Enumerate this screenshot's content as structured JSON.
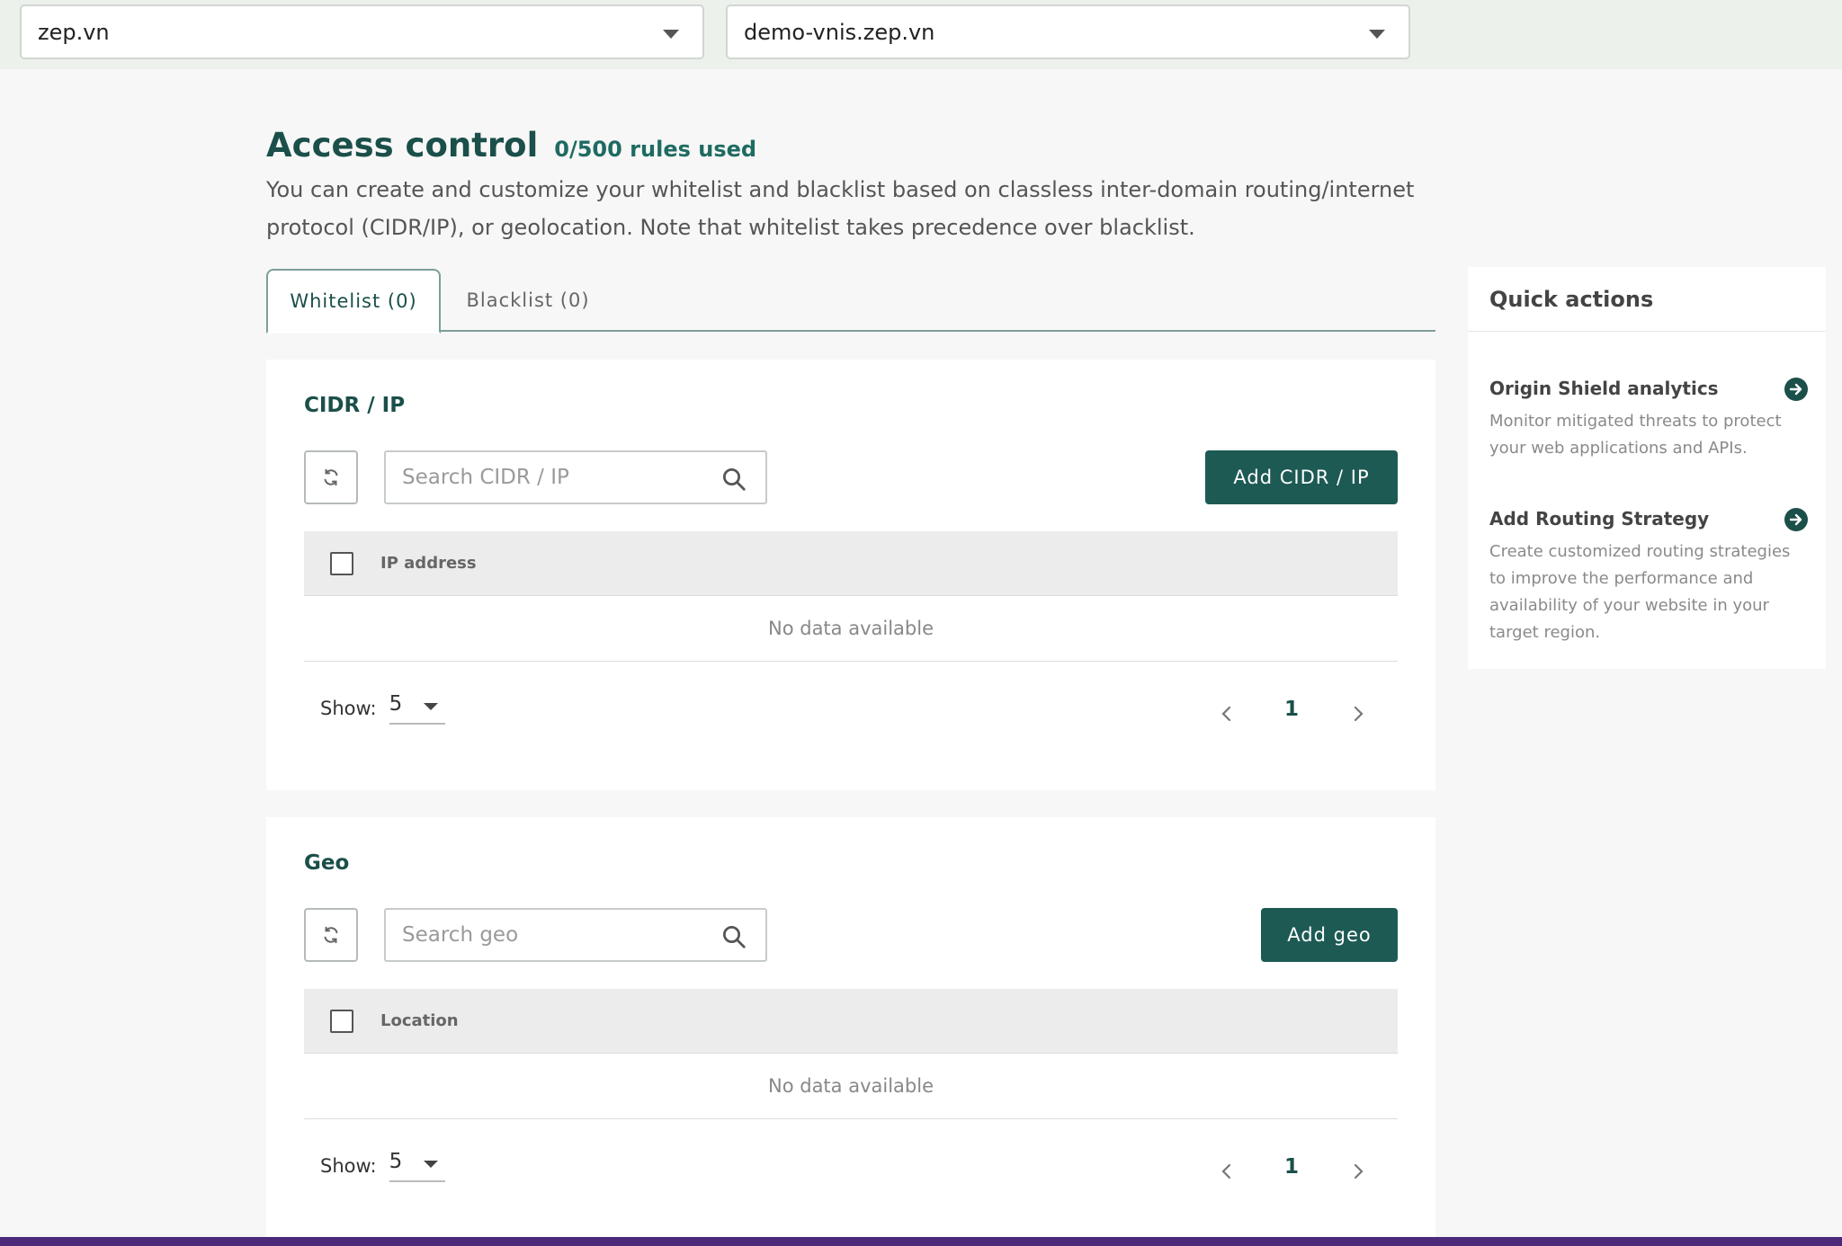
{
  "topbar": {
    "domain_select": "zep.vn",
    "subdomain_select": "demo-vnis.zep.vn"
  },
  "header": {
    "title": "Access control",
    "rules_used": "0/500 rules used",
    "description": "You can create and customize your whitelist and blacklist based on classless inter-domain routing/internet protocol (CIDR/IP), or geolocation. Note that whitelist takes precedence over blacklist."
  },
  "tabs": [
    {
      "label": "Whitelist (0)",
      "active": true
    },
    {
      "label": "Blacklist (0)",
      "active": false
    }
  ],
  "cidr": {
    "title": "CIDR / IP",
    "search_placeholder": "Search CIDR / IP",
    "add_label": "Add CIDR / IP",
    "column": "IP address",
    "empty": "No data available",
    "show_label": "Show:",
    "page_size": "5",
    "page": "1"
  },
  "geo": {
    "title": "Geo",
    "search_placeholder": "Search geo",
    "add_label": "Add geo",
    "column": "Location",
    "empty": "No data available",
    "show_label": "Show:",
    "page_size": "5",
    "page": "1"
  },
  "quick_actions": {
    "title": "Quick actions",
    "items": [
      {
        "title": "Origin Shield analytics",
        "description": "Monitor mitigated threats to protect your web applications and APIs.",
        "icon": "arrow-right-circle-icon"
      },
      {
        "title": "Add Routing Strategy",
        "description": "Create customized routing strategies to improve the performance and availability of your website in your target region.",
        "icon": "arrow-right-circle-icon"
      }
    ]
  },
  "colors": {
    "primary": "#1d5a54",
    "title": "#1b4f4a",
    "background": "#f6f7f6"
  }
}
